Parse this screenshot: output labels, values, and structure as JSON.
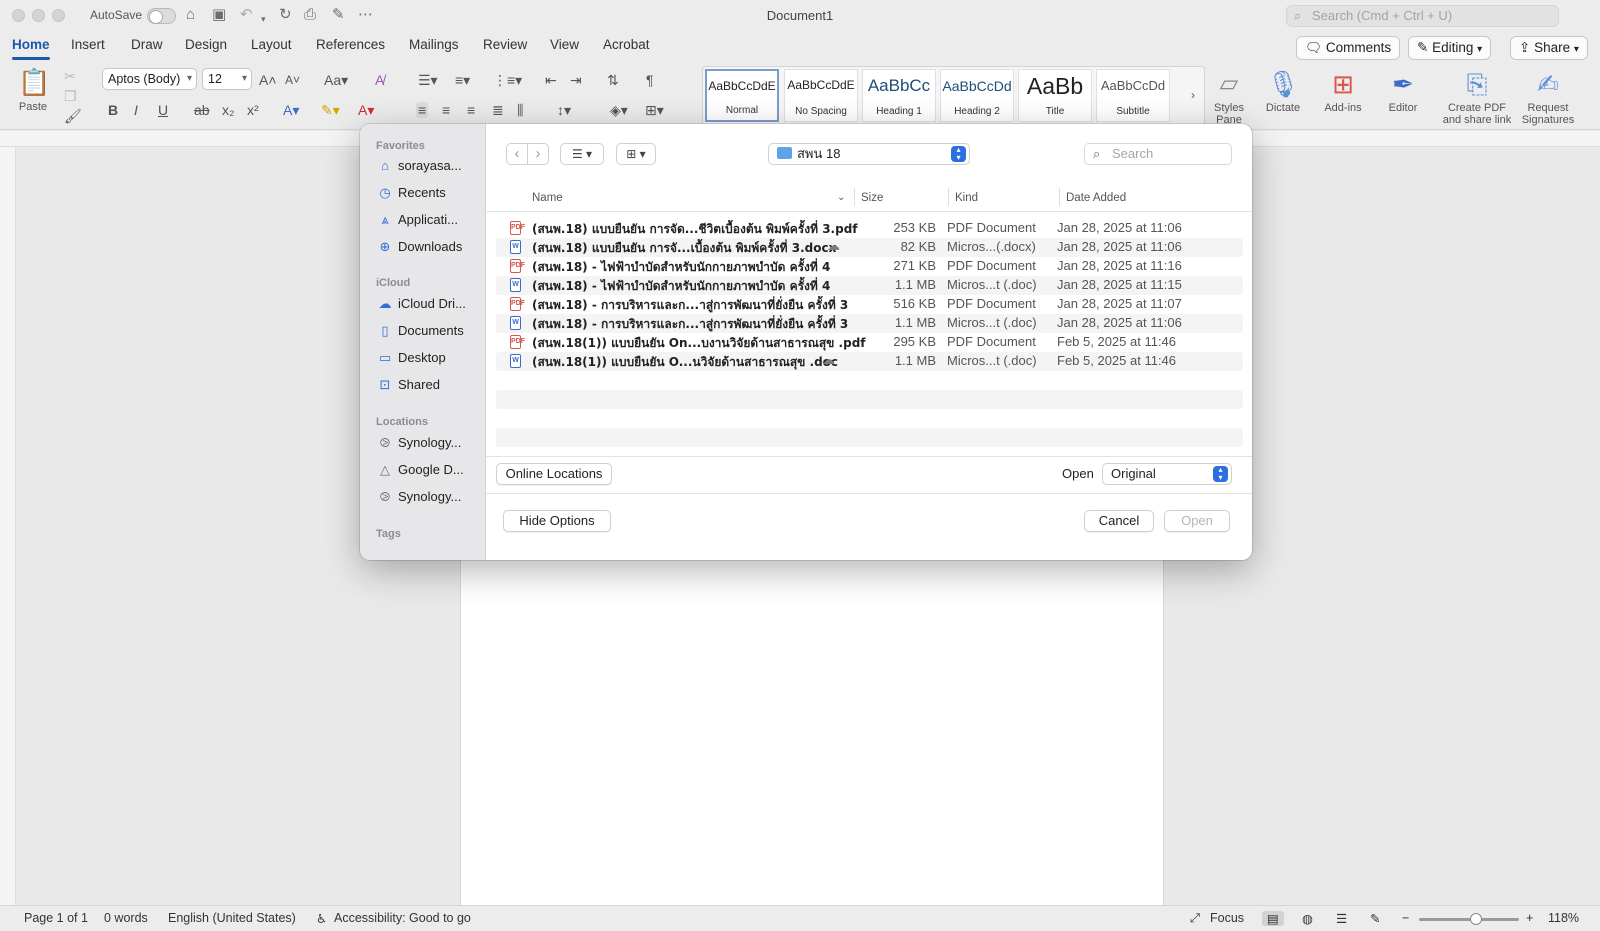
{
  "window": {
    "autosave_label": "AutoSave",
    "title": "Document1",
    "search_placeholder": "Search (Cmd + Ctrl + U)"
  },
  "ribbon_tabs": [
    "Home",
    "Insert",
    "Draw",
    "Design",
    "Layout",
    "References",
    "Mailings",
    "Review",
    "View",
    "Acrobat"
  ],
  "ribbon_right": {
    "comments_label": "Comments",
    "editing_label": "Editing",
    "share_label": "Share"
  },
  "toolbar": {
    "paste_label": "Paste",
    "font_name": "Aptos (Body)",
    "font_size": "12",
    "styles": [
      {
        "sample": "AaBbCcDdE",
        "name": "Normal"
      },
      {
        "sample": "AaBbCcDdE",
        "name": "No Spacing"
      },
      {
        "sample": "AaBbCc",
        "name": "Heading 1"
      },
      {
        "sample": "AaBbCcDd",
        "name": "Heading 2"
      },
      {
        "sample": "AaBb",
        "name": "Title"
      },
      {
        "sample": "AaBbCcDd",
        "name": "Subtitle"
      }
    ],
    "styles_pane_label": "Styles Pane",
    "dictate_label": "Dictate",
    "addins_label": "Add-ins",
    "editor_label": "Editor",
    "create_pdf_label": "Create PDF and share link",
    "request_signatures_label": "Request Signatures"
  },
  "dialog": {
    "sidebar": {
      "favorites_header": "Favorites",
      "favorites": [
        "sorayasa...",
        "Recents",
        "Applicati...",
        "Downloads"
      ],
      "icloud_header": "iCloud",
      "icloud": [
        "iCloud Dri...",
        "Documents",
        "Desktop",
        "Shared"
      ],
      "locations_header": "Locations",
      "locations": [
        "Synology...",
        "Google D...",
        "Synology..."
      ],
      "tags_header": "Tags"
    },
    "folder_name": "สพน 18",
    "search_placeholder": "Search",
    "columns": {
      "name": "Name",
      "size": "Size",
      "kind": "Kind",
      "date": "Date Added"
    },
    "files": [
      {
        "name": "(สนพ.18) แบบยืนยัน การจัด...ชีวิตเบื้องต้น พิมพ์ครั้งที่ 3.pdf",
        "size": "253 KB",
        "kind": "PDF Document",
        "date": "Jan 28, 2025 at 11:06"
      },
      {
        "name": "(สนพ.18) แบบยืนยัน การจั...เบื้องต้น พิมพ์ครั้งที่ 3.docx",
        "size": "82 KB",
        "kind": "Micros...(.docx)",
        "date": "Jan 28, 2025 at 11:06"
      },
      {
        "name": "(สนพ.18) -  ไฟฟ้าบำบัดสำหรับนักกายภาพบำบัด ครั้งที่ 4",
        "size": "271 KB",
        "kind": "PDF Document",
        "date": "Jan 28, 2025 at 11:16"
      },
      {
        "name": "(สนพ.18) -  ไฟฟ้าบำบัดสำหรับนักกายภาพบำบัด ครั้งที่ 4",
        "size": "1.1 MB",
        "kind": "Micros...t (.doc)",
        "date": "Jan 28, 2025 at 11:15"
      },
      {
        "name": "(สนพ.18) -  การบริหารและก...าสู่การพัฒนาที่ยั่งยืน ครั้งที่ 3",
        "size": "516 KB",
        "kind": "PDF Document",
        "date": "Jan 28, 2025 at 11:07"
      },
      {
        "name": "(สนพ.18) -  การบริหารและก...าสู่การพัฒนาที่ยั่งยืน ครั้งที่ 3",
        "size": "1.1 MB",
        "kind": "Micros...t (.doc)",
        "date": "Jan 28, 2025 at 11:06"
      },
      {
        "name": "(สนพ.18(1)) แบบยืนยัน On...บงานวิจัยด้านสาธารณสุข .pdf",
        "size": "295 KB",
        "kind": "PDF Document",
        "date": "Feb 5, 2025 at 11:46"
      },
      {
        "name": "(สนพ.18(1)) แบบยืนยัน O...นวิจัยด้านสาธารณสุข .doc",
        "size": "1.1 MB",
        "kind": "Micros...t (.doc)",
        "date": "Feb 5, 2025 at 11:46"
      }
    ],
    "online_locations_label": "Online Locations",
    "open_label": "Open",
    "open_mode": "Original",
    "hide_options_label": "Hide Options",
    "cancel_label": "Cancel",
    "open_button_label": "Open"
  },
  "status": {
    "page": "Page 1 of 1",
    "words": "0 words",
    "language": "English (United States)",
    "accessibility": "Accessibility: Good to go",
    "focus_label": "Focus",
    "zoom": "118%",
    "zoom_level": 0.58
  }
}
